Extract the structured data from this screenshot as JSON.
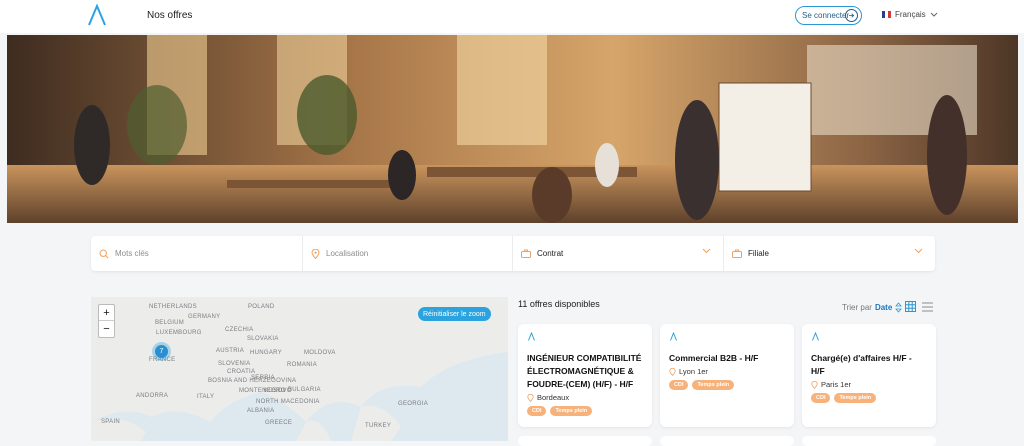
{
  "header": {
    "nav_offers": "Nos offres",
    "login_label": "Se connecter",
    "language": "Français"
  },
  "search": {
    "keywords_placeholder": "Mots clés",
    "location_placeholder": "Localisation",
    "contract_label": "Contrat",
    "subsidiary_label": "Filiale"
  },
  "map": {
    "reset_zoom_label": "Réinitialiser le zoom",
    "cluster_count": "7",
    "zoom_in": "+",
    "zoom_out": "−",
    "countries": [
      "NETHERLANDS",
      "POLAND",
      "GERMANY",
      "BELGIUM",
      "LUXEMBOURG",
      "CZECHIA",
      "SLOVAKIA",
      "AUSTRIA",
      "HUNGARY",
      "MOLDOVA",
      "FRANCE",
      "SLOVENIA",
      "CROATIA",
      "ROMANIA",
      "SERBIA",
      "BOSNIA AND HERZEGOVINA",
      "MONTENEGRO",
      "KOSOVO",
      "BULGARIA",
      "NORTH MACEDONIA",
      "ALBANIA",
      "ITALY",
      "ANDORRA",
      "GREECE",
      "SPAIN",
      "GEORGIA",
      "TURKEY"
    ]
  },
  "results": {
    "count_label": "11 offres disponibles",
    "sort_prefix": "Trier par",
    "sort_value": "Date"
  },
  "jobs": [
    {
      "title": "INGÉNIEUR COMPATIBILITÉ ÉLECTROMAGNÉTIQUE & FOUDRE-(CEM) (H/F) - H/F",
      "location": "Bordeaux",
      "badges": [
        "CDI",
        "Temps plein"
      ]
    },
    {
      "title": "Commercial B2B - H/F",
      "location": "Lyon 1er",
      "badges": [
        "CDI",
        "Temps plein"
      ]
    },
    {
      "title": "Chargé(e) d'affaires H/F - H/F",
      "location": "Paris 1er",
      "badges": [
        "CDI",
        "Temps plein"
      ]
    }
  ],
  "colors": {
    "accent": "#2a98d4",
    "badge": "#f6b27a",
    "icon_orange": "#f0a060"
  }
}
